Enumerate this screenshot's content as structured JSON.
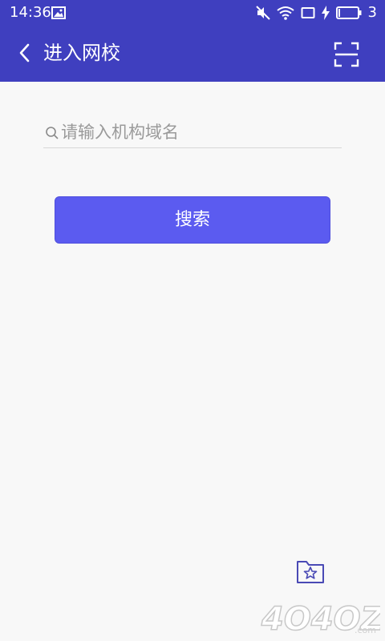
{
  "status_bar": {
    "time": "14:36",
    "battery_level": "3",
    "icons": [
      "gallery-icon",
      "mute-icon",
      "wifi-icon",
      "screen-icon",
      "charging-icon",
      "battery-icon"
    ]
  },
  "app_bar": {
    "title": "进入网校",
    "background": "#3f3fbf",
    "icons": [
      "back-arrow-icon",
      "scan-icon"
    ]
  },
  "search": {
    "placeholder": "请输入机构域名",
    "value": ""
  },
  "search_button": {
    "label": "搜索",
    "color": "#5b5bf0"
  },
  "favorites": {
    "icon": "star-folder-icon"
  },
  "watermark": {
    "text": "4O4OZ",
    "suffix": ".com"
  }
}
